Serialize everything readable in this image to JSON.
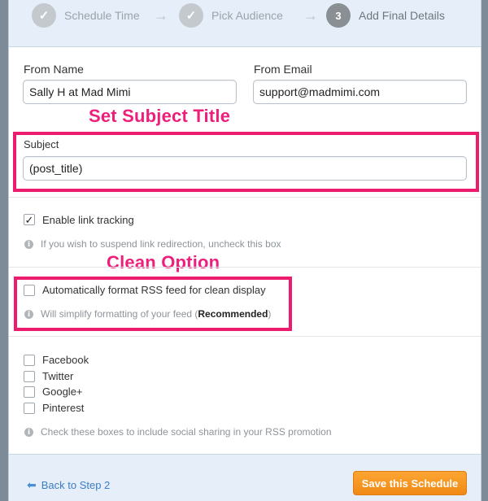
{
  "steps": [
    {
      "icon": "check-icon",
      "glyph": "✓",
      "label": "Schedule Time",
      "state": "complete"
    },
    {
      "icon": "check-icon",
      "glyph": "✓",
      "label": "Pick Audience",
      "state": "complete"
    },
    {
      "icon": "step-number",
      "glyph": "3",
      "label": "Add Final Details",
      "state": "current"
    }
  ],
  "step_arrow_glyph": "→",
  "from_name": {
    "label": "From Name",
    "value": "Sally H at Mad Mimi"
  },
  "from_email": {
    "label": "From Email",
    "value": "support@madmimi.com"
  },
  "subject": {
    "label": "Subject",
    "value": "(post_title)"
  },
  "callouts": {
    "subject": "Set Subject Title",
    "clean": "Clean Option"
  },
  "link_tracking": {
    "label": "Enable link tracking",
    "checked": true,
    "check_glyph": "✓",
    "hint": "If you wish to suspend link redirection, uncheck this box"
  },
  "rss_format": {
    "label": "Automatically format RSS feed for clean display",
    "checked": false,
    "hint_prefix": "Will simplify formatting of your feed (",
    "hint_bold": "Recommended",
    "hint_suffix": ")"
  },
  "social": {
    "items": [
      "Facebook",
      "Twitter",
      "Google+",
      "Pinterest"
    ],
    "hint": "Check these boxes to include social sharing in your RSS promotion"
  },
  "info_glyph": "i",
  "footer": {
    "back_label": "Back to Step 2",
    "back_glyph": "⬅",
    "save_label": "Save this Schedule"
  },
  "colors": {
    "accent_callout": "#ee1f7a",
    "highlight_border": "#ec1b6e",
    "save_button": "#f5961f",
    "link": "#3b7ec4",
    "header_bg": "#e5eef9"
  }
}
